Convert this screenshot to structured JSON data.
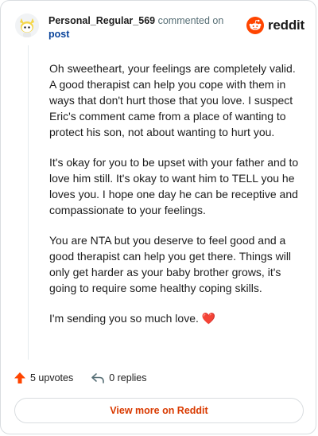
{
  "header": {
    "username": "Personal_Regular_569",
    "commented_on": "commented on",
    "post_link": "post",
    "brand": "reddit"
  },
  "comment": {
    "paragraphs": [
      "Oh sweetheart, your feelings are completely valid. A good therapist can help you cope with them in ways that don't hurt those that you love. I suspect Eric's comment came from a place of wanting to protect his son, not about wanting to hurt you.",
      "It's okay for you to be upset with your father and to love him still. It's okay to want him to TELL you he loves you. I hope one day he can be receptive and compassionate to your feelings.",
      "You are NTA but you deserve to feel good and a good therapist can help you get there. Things will only get harder as your baby brother grows, it's going to require some healthy coping skills.",
      "I'm sending you so much love."
    ],
    "emoji": "❤️"
  },
  "actions": {
    "upvotes": "5 upvotes",
    "replies": "0 replies"
  },
  "footer": {
    "view_more": "View more on Reddit"
  },
  "colors": {
    "brand_orange": "#ff4500",
    "link_blue": "#0a449b",
    "cta_text": "#d93a00"
  },
  "icons": {
    "avatar": "snoo-avatar-icon",
    "logo": "reddit-alien-icon",
    "upvote": "upvote-arrow-icon",
    "reply": "reply-arrow-icon"
  }
}
